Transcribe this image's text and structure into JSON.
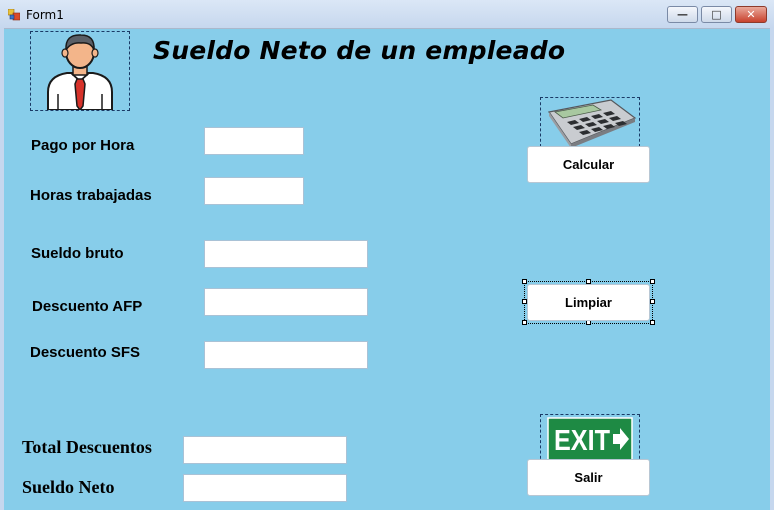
{
  "window": {
    "title": "Form1",
    "minimize_glyph": "—",
    "maximize_glyph": "□",
    "close_glyph": "✕"
  },
  "heading": "Sueldo Neto de un empleado",
  "labels": {
    "pago_hora": "Pago por Hora",
    "horas": "Horas trabajadas",
    "sueldo_bruto": "Sueldo bruto",
    "afp": "Descuento AFP",
    "sfs": "Descuento SFS",
    "total_desc": "Total Descuentos",
    "sueldo_neto": "Sueldo Neto"
  },
  "inputs": {
    "pago_hora": "",
    "horas": "",
    "sueldo_bruto": "",
    "afp": "",
    "sfs": "",
    "total_desc": "",
    "sueldo_neto": ""
  },
  "buttons": {
    "calcular": "Calcular",
    "limpiar": "Limpiar",
    "salir": "Salir"
  },
  "exit_sign": "EXIT",
  "colors": {
    "form_bg": "#87cdea",
    "exit_green": "#1e8a44"
  },
  "icons": [
    "employee-icon",
    "calculator-icon",
    "exit-sign-icon"
  ]
}
